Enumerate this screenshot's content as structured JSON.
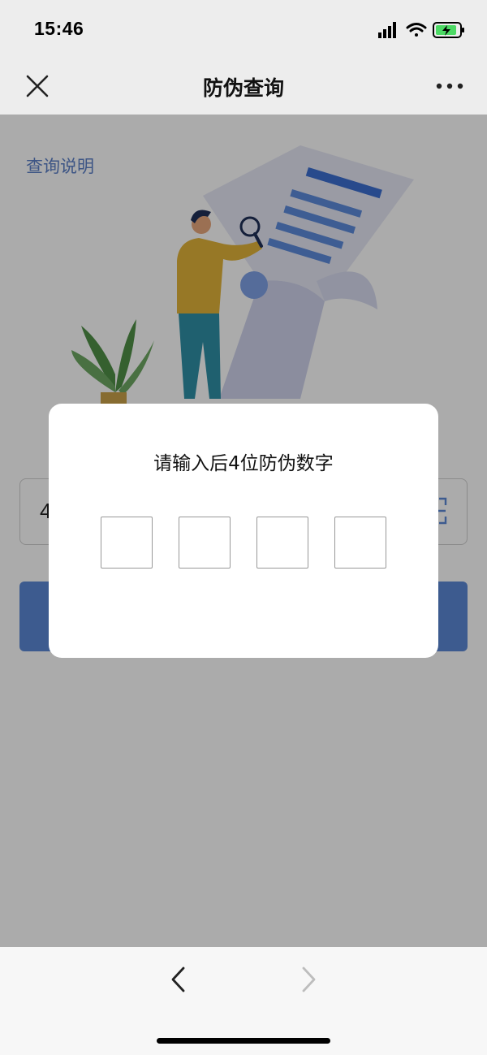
{
  "status": {
    "time": "15:46"
  },
  "nav": {
    "title": "防伪查询"
  },
  "content": {
    "help_link": "查询说明",
    "code_value_visible": "4"
  },
  "dialog": {
    "title": "请输入后4位防伪数字",
    "digits": [
      "",
      "",
      "",
      ""
    ]
  },
  "colors": {
    "accent": "#5b88d6",
    "link": "#5b7fc7",
    "bar_bg": "#ededed"
  },
  "icons": [
    "close-icon",
    "more-icon",
    "signal-icon",
    "wifi-icon",
    "battery-icon",
    "scan-icon",
    "back-arrow-icon",
    "forward-arrow-icon"
  ]
}
